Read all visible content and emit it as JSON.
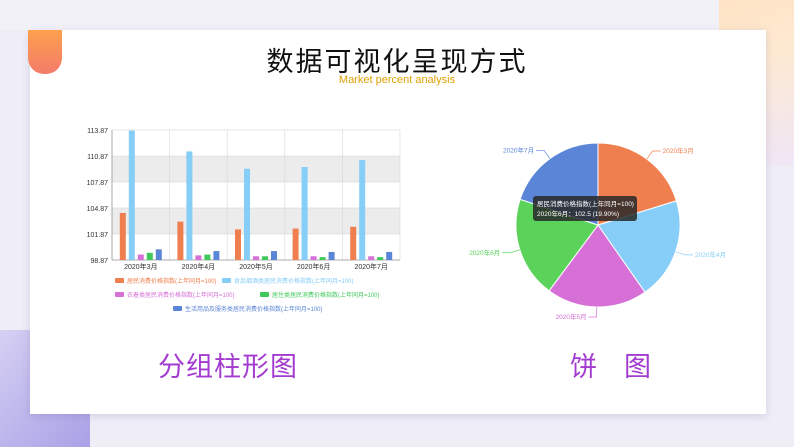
{
  "slide": {
    "title": "数据可视化呈现方式",
    "subtitle": "Market percent analysis",
    "bar_caption": "分组柱形图",
    "pie_caption": "饼　图"
  },
  "colors": {
    "accent": "#fda04d",
    "caption": "#a33bd0",
    "subtitle": "#e0a106"
  },
  "chart_data": [
    {
      "type": "bar",
      "categories": [
        "2020年3月",
        "2020年4月",
        "2020年5月",
        "2020年6月",
        "2020年7月"
      ],
      "series": [
        {
          "name": "居民消费价格指数(上年同月=100)",
          "color": "#f07f4f",
          "values": [
            104.3,
            103.3,
            102.4,
            102.5,
            102.7
          ]
        },
        {
          "name": "食品烟酒类居民消费价格指数(上年同月=100)",
          "color": "#86cdf7",
          "values": [
            113.8,
            111.4,
            109.4,
            109.6,
            110.4
          ]
        },
        {
          "name": "衣着类居民消费价格指数(上年同月=100)",
          "color": "#d66fd6",
          "values": [
            99.5,
            99.4,
            99.3,
            99.3,
            99.3
          ]
        },
        {
          "name": "居住类居民消费价格指数(上年同月=100)",
          "color": "#3ec95a",
          "values": [
            99.7,
            99.5,
            99.3,
            99.2,
            99.2
          ]
        },
        {
          "name": "生活用品及服务类居民消费价格指数(上年同月=100)",
          "color": "#5b86d8",
          "values": [
            100.1,
            99.9,
            99.9,
            99.8,
            99.8
          ]
        }
      ],
      "yticks": [
        "98.87",
        "101.87",
        "104.87",
        "107.87",
        "110.87",
        "113.87"
      ],
      "ylim": [
        98.87,
        113.87
      ],
      "grid": true,
      "legend": "bottom"
    },
    {
      "type": "pie",
      "labels": [
        "2020年3月",
        "2020年4月",
        "2020年5月",
        "2020年6月",
        "2020年7月"
      ],
      "values": [
        104.3,
        103.3,
        102.4,
        102.5,
        102.7
      ],
      "colors": [
        "#f07f4f",
        "#86cdf7",
        "#d66fd6",
        "#5bd35b",
        "#5b86d8"
      ],
      "tooltip": {
        "title": "居民消费价格指数(上年同月=100)",
        "text": "2020年6月：102.5 (19.90%)"
      }
    }
  ]
}
